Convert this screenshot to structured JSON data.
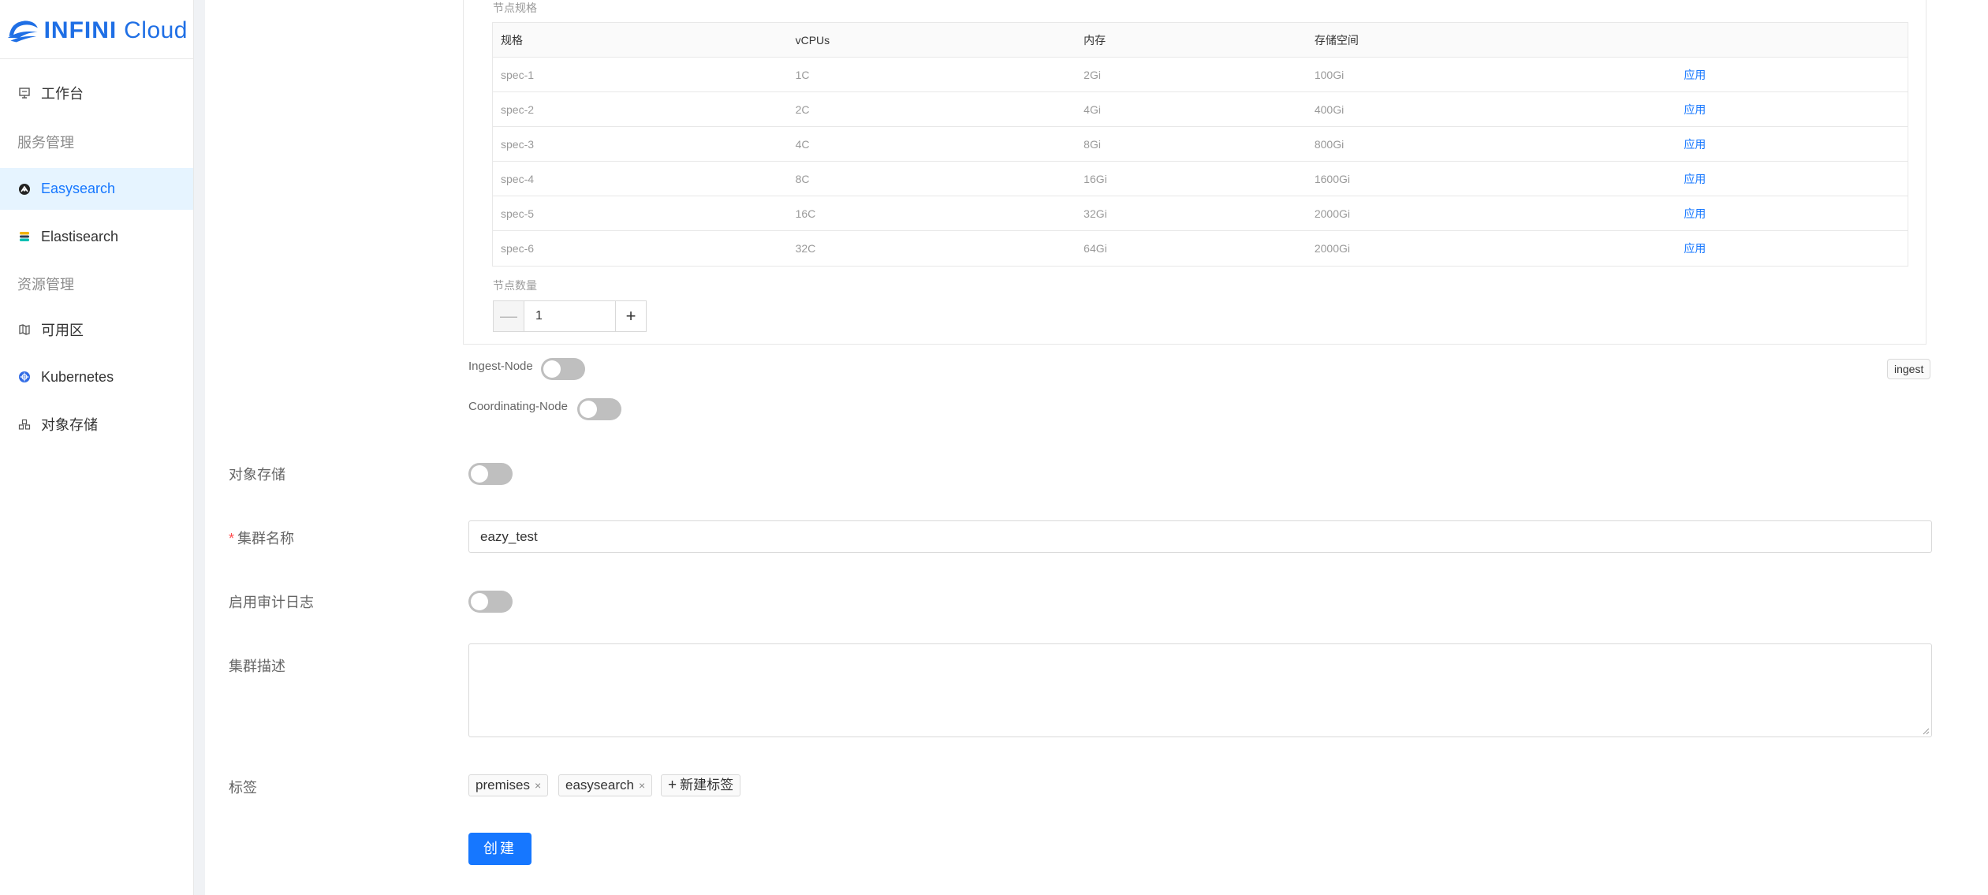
{
  "brand": {
    "name_bold": "INFINI",
    "name_light": "Cloud"
  },
  "sidebar": {
    "items": [
      {
        "label": "工作台",
        "icon": "workbench-icon"
      },
      {
        "group": "服务管理"
      },
      {
        "label": "Easysearch",
        "icon": "easysearch-icon",
        "active": true
      },
      {
        "label": "Elastisearch",
        "icon": "elasticsearch-icon"
      },
      {
        "group": "资源管理"
      },
      {
        "label": "可用区",
        "icon": "map-icon"
      },
      {
        "label": "Kubernetes",
        "icon": "kubernetes-icon"
      },
      {
        "label": "对象存储",
        "icon": "storage-icon"
      }
    ]
  },
  "spec": {
    "title": "节点规格",
    "headers": [
      "规格",
      "vCPUs",
      "内存",
      "存储空间",
      ""
    ],
    "rows": [
      [
        "spec-1",
        "1C",
        "2Gi",
        "100Gi",
        "应用"
      ],
      [
        "spec-2",
        "2C",
        "4Gi",
        "400Gi",
        "应用"
      ],
      [
        "spec-3",
        "4C",
        "8Gi",
        "800Gi",
        "应用"
      ],
      [
        "spec-4",
        "8C",
        "16Gi",
        "1600Gi",
        "应用"
      ],
      [
        "spec-5",
        "16C",
        "32Gi",
        "2000Gi",
        "应用"
      ],
      [
        "spec-6",
        "32C",
        "64Gi",
        "2000Gi",
        "应用"
      ]
    ],
    "count_label": "节点数量",
    "count_value": "1",
    "minus": "—",
    "plus": "+"
  },
  "switches": {
    "ingest_node": "Ingest-Node",
    "coordinating_node": "Coordinating-Node",
    "ingest_tag": "ingest"
  },
  "form": {
    "object_storage_label": "对象存储",
    "cluster_name_label": "集群名称",
    "cluster_name_value": "eazy_test",
    "audit_log_label": "启用审计日志",
    "description_label": "集群描述",
    "tags_label": "标签",
    "tags": [
      "premises",
      "easysearch"
    ],
    "new_tag": "新建标签",
    "create_button": "创建"
  },
  "colors": {
    "accent": "#1677ff",
    "required": "#ff4d4f"
  }
}
